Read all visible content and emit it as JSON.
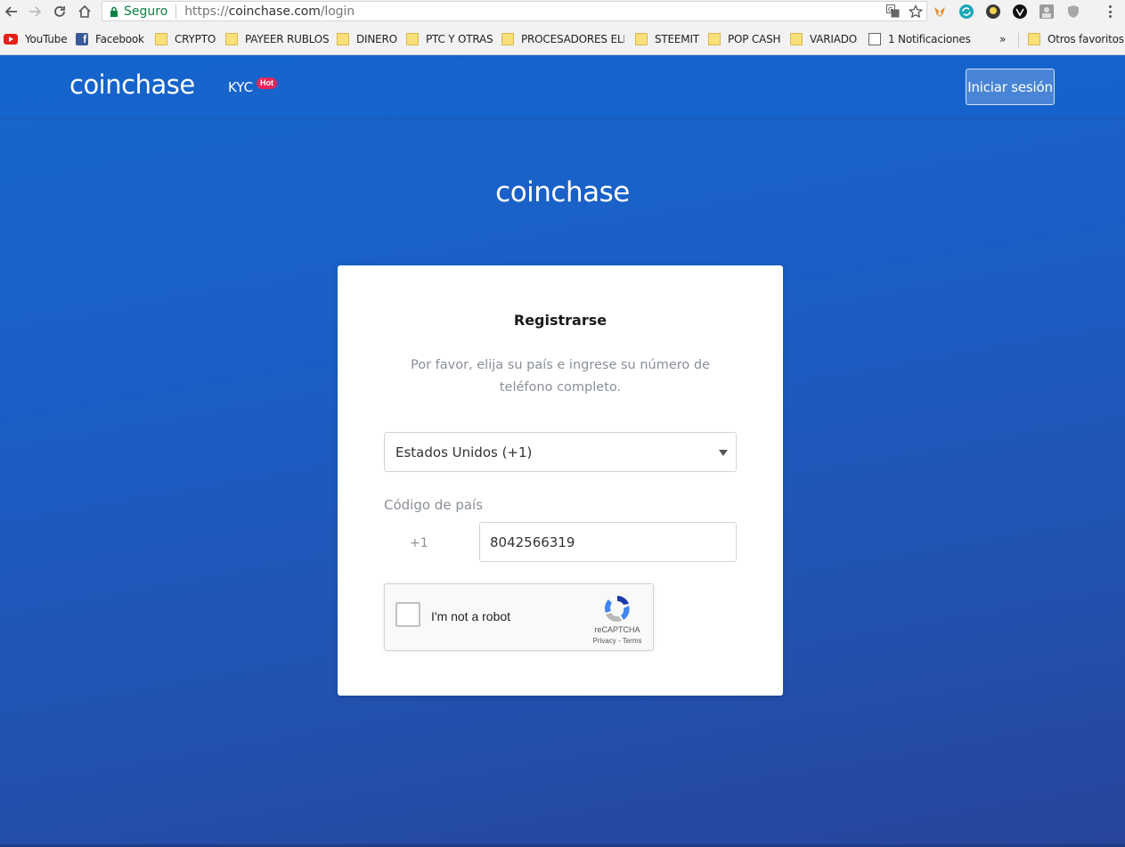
{
  "browser": {
    "secure_label": "Seguro",
    "url_scheme": "https://",
    "url_host": "coinchase.com",
    "url_path": "/login",
    "bookmarks": [
      {
        "label": "YouTube",
        "icon": "youtube-icon"
      },
      {
        "label": "Facebook",
        "icon": "facebook-icon"
      },
      {
        "label": "CRYPTO",
        "icon": "folder-icon"
      },
      {
        "label": "PAYEER RUBLOS",
        "icon": "folder-icon"
      },
      {
        "label": "DINERO",
        "icon": "folder-icon"
      },
      {
        "label": "PTC Y OTRAS",
        "icon": "folder-icon"
      },
      {
        "label": "PROCESADORES ELEC",
        "icon": "folder-icon"
      },
      {
        "label": "STEEMIT",
        "icon": "folder-icon"
      },
      {
        "label": "POP CASH",
        "icon": "folder-icon"
      },
      {
        "label": "VARIADO",
        "icon": "folder-icon"
      },
      {
        "label": "1 Notificaciones",
        "icon": "page-icon"
      }
    ],
    "overflow_label": "»",
    "other_bookmarks": "Otros favoritos"
  },
  "header": {
    "brand": "coinchase",
    "kyc_label": "KYC",
    "hot_badge": "Hot",
    "login_label": "Iniciar sesión"
  },
  "main": {
    "brand": "coinchase",
    "card": {
      "title": "Registrarse",
      "subtitle": "Por favor, elija su país e ingrese su número de teléfono completo.",
      "country_selected": "Estados Unidos (+1)",
      "code_label": "Código de país",
      "code_value": "+1",
      "phone_value": "8042566319",
      "recaptcha": {
        "label": "I'm not a robot",
        "brand": "reCAPTCHA",
        "links": "Privacy - Terms"
      }
    }
  },
  "colors": {
    "accent_blue": "#1866cc",
    "hot_badge": "#e8245c",
    "secure_green": "#0b8043"
  }
}
